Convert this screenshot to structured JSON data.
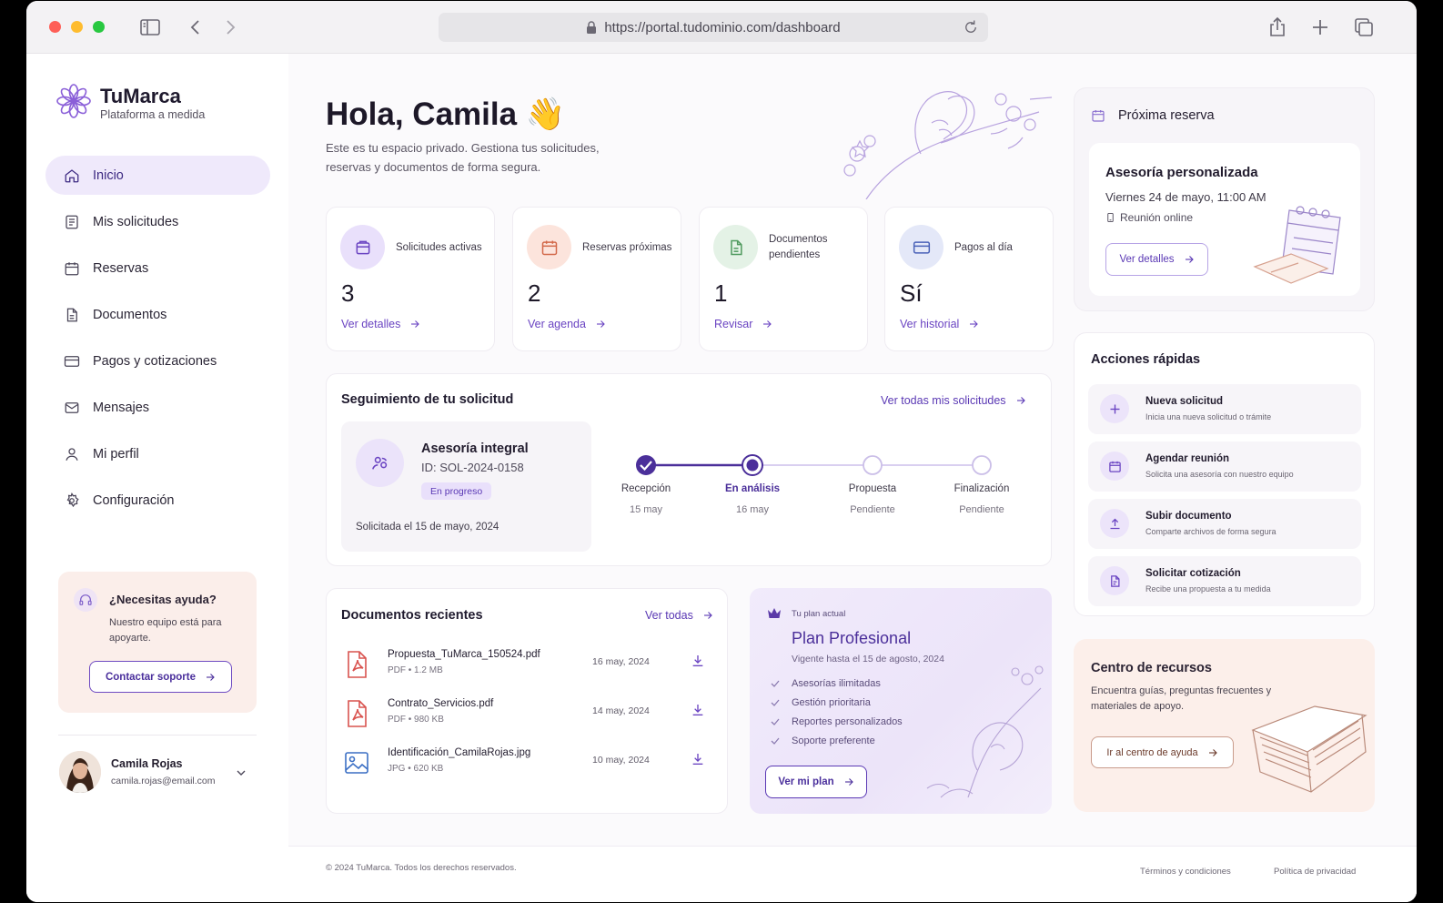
{
  "browser": {
    "url": "https://portal.tudominio.com/dashboard"
  },
  "brand": {
    "name": "TuMarca",
    "tagline": "Plataforma a medida"
  },
  "sidebar": {
    "items": [
      {
        "label": "Inicio",
        "icon": "home-icon",
        "active": true
      },
      {
        "label": "Mis solicitudes",
        "icon": "list-icon"
      },
      {
        "label": "Reservas",
        "icon": "calendar-icon"
      },
      {
        "label": "Documentos",
        "icon": "document-icon"
      },
      {
        "label": "Pagos y cotizaciones",
        "icon": "card-icon"
      },
      {
        "label": "Mensajes",
        "icon": "mail-icon"
      },
      {
        "label": "Mi perfil",
        "icon": "user-icon"
      },
      {
        "label": "Configuración",
        "icon": "gear-icon"
      }
    ],
    "help": {
      "title": "¿Necesitas ayuda?",
      "text": "Nuestro equipo está para apoyarte.",
      "button": "Contactar soporte"
    },
    "user": {
      "name": "Camila Rojas",
      "email": "camila.rojas@email.com"
    }
  },
  "hero": {
    "greeting": "Hola, Camila 👋",
    "subtitle": "Este es tu espacio privado. Gestiona tus solicitudes, reservas y documentos de forma segura."
  },
  "stats": [
    {
      "label": "Solicitudes activas",
      "value": "3",
      "link": "Ver detalles",
      "color": "#e9e0fb",
      "icon": "folder-icon"
    },
    {
      "label": "Reservas próximas",
      "value": "2",
      "link": "Ver agenda",
      "color": "#fce4dc",
      "icon": "calendar-icon"
    },
    {
      "label": "Documentos pendientes",
      "value": "1",
      "link": "Revisar",
      "color": "#e4f2e6",
      "icon": "document-icon"
    },
    {
      "label": "Pagos al día",
      "value": "Sí",
      "link": "Ver historial",
      "color": "#e4e8f8",
      "icon": "card-icon"
    }
  ],
  "tracking": {
    "title": "Seguimiento de tu solicitud",
    "link": "Ver todas mis solicitudes",
    "request": {
      "name": "Asesoría integral",
      "id": "ID: SOL-2024-0158",
      "status": "En progreso",
      "requested": "Solicitada el 15 de mayo, 2024"
    },
    "steps": [
      {
        "label": "Recepción",
        "date": "15 may",
        "state": "done"
      },
      {
        "label": "En análisis",
        "date": "16 may",
        "state": "current"
      },
      {
        "label": "Propuesta",
        "date": "Pendiente",
        "state": "pending"
      },
      {
        "label": "Finalización",
        "date": "Pendiente",
        "state": "pending"
      }
    ]
  },
  "documents": {
    "title": "Documentos recientes",
    "link": "Ver todas",
    "items": [
      {
        "name": "Propuesta_TuMarca_150524.pdf",
        "meta": "PDF • 1.2 MB",
        "date": "16 may, 2024",
        "type": "pdf"
      },
      {
        "name": "Contrato_Servicios.pdf",
        "meta": "PDF • 980 KB",
        "date": "14 may, 2024",
        "type": "pdf"
      },
      {
        "name": "Identificación_CamilaRojas.jpg",
        "meta": "JPG • 620 KB",
        "date": "10 may, 2024",
        "type": "image"
      }
    ]
  },
  "plan": {
    "kicker": "Tu plan actual",
    "name": "Plan Profesional",
    "valid": "Vigente hasta el 15 de agosto, 2024",
    "features": [
      "Asesorías ilimitadas",
      "Gestión prioritaria",
      "Reportes personalizados",
      "Soporte preferente"
    ],
    "button": "Ver mi plan"
  },
  "next_booking": {
    "heading": "Próxima reserva",
    "title": "Asesoría personalizada",
    "date": "Viernes 24 de mayo, 11:00 AM",
    "mode": "Reunión online",
    "button": "Ver detalles"
  },
  "quick_actions": {
    "title": "Acciones rápidas",
    "items": [
      {
        "title": "Nueva solicitud",
        "subtitle": "Inicia una nueva solicitud o trámite",
        "icon": "plus-icon"
      },
      {
        "title": "Agendar reunión",
        "subtitle": "Solicita una asesoría con nuestro equipo",
        "icon": "calendar-icon"
      },
      {
        "title": "Subir documento",
        "subtitle": "Comparte archivos de forma segura",
        "icon": "upload-icon"
      },
      {
        "title": "Solicitar cotización",
        "subtitle": "Recibe una propuesta a tu medida",
        "icon": "quote-icon"
      }
    ]
  },
  "resources": {
    "title": "Centro de recursos",
    "text": "Encuentra guías, preguntas frecuentes y materiales de apoyo.",
    "button": "Ir al centro de ayuda"
  },
  "footer": {
    "copyright": "© 2024 TuMarca. Todos los derechos reservados.",
    "terms": "Términos y condiciones",
    "privacy": "Política de privacidad"
  }
}
